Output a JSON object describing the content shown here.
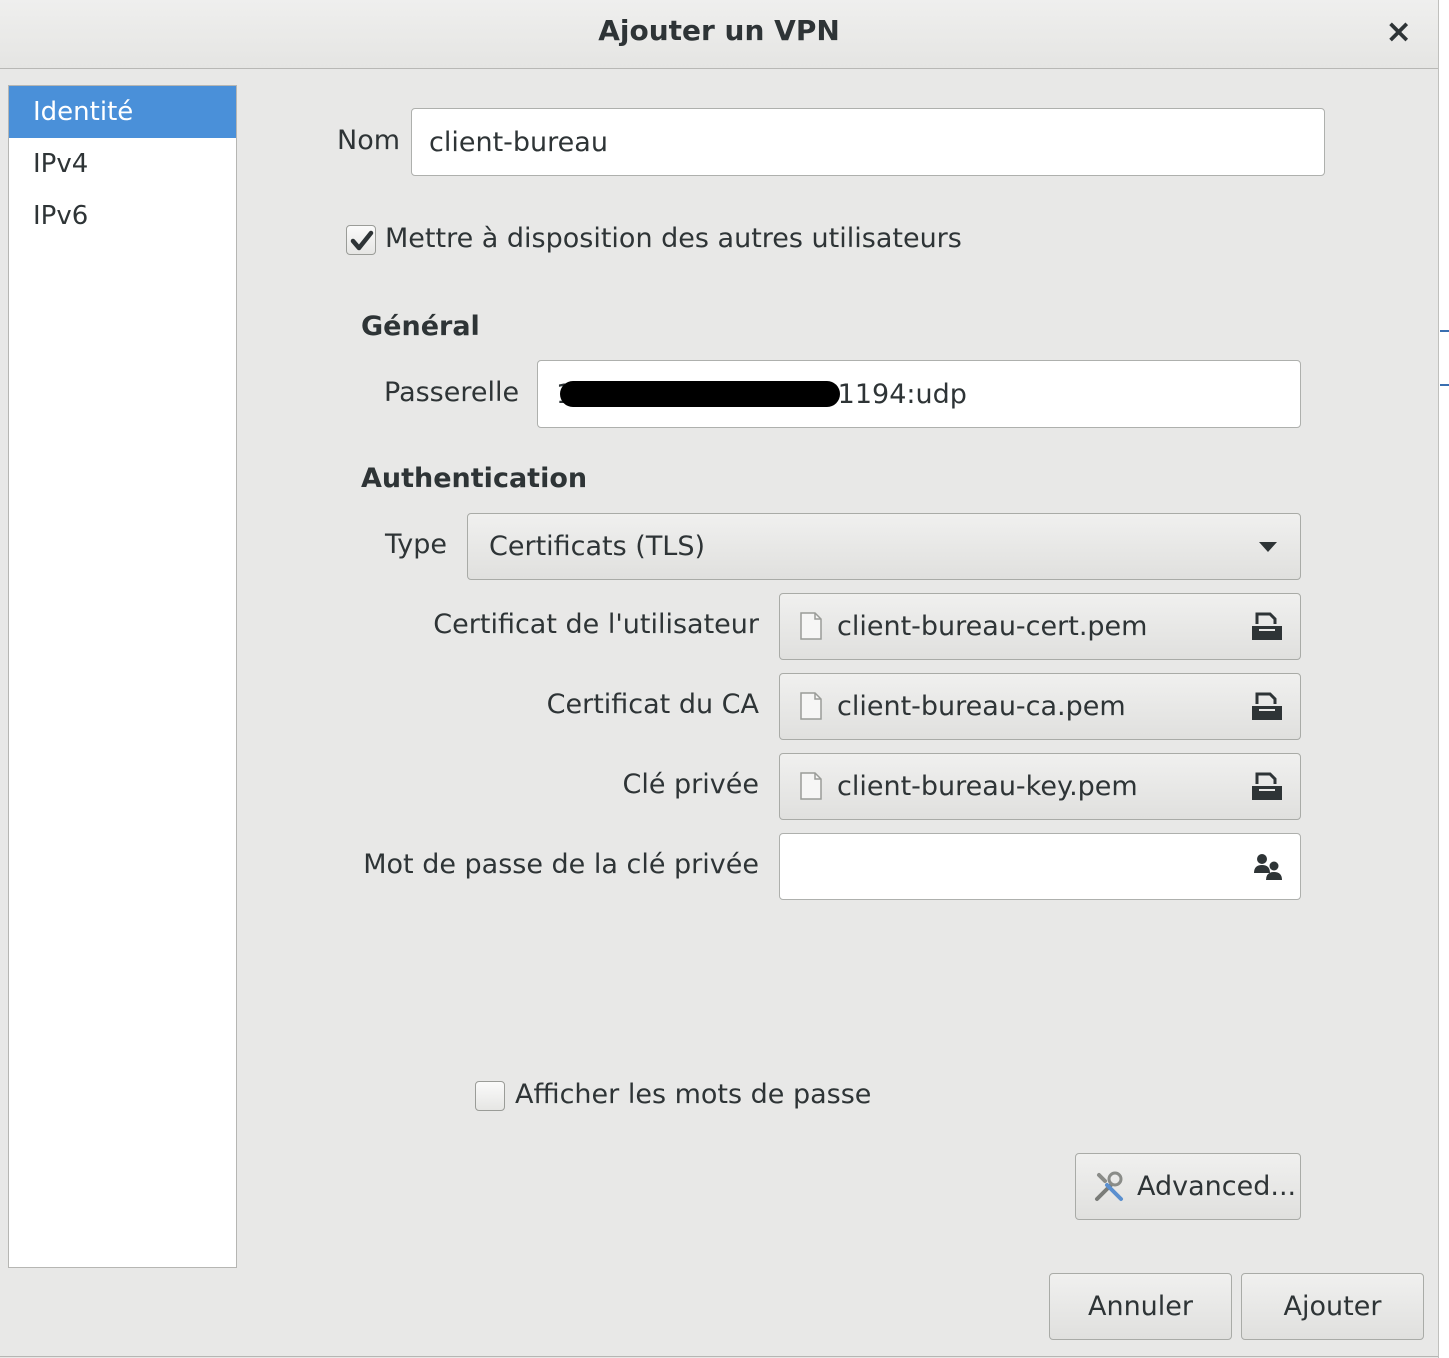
{
  "window": {
    "title": "Ajouter un VPN",
    "close_glyph": "×"
  },
  "sidebar": {
    "items": [
      {
        "label": "Identité",
        "selected": true
      },
      {
        "label": "IPv4",
        "selected": false
      },
      {
        "label": "IPv6",
        "selected": false
      }
    ]
  },
  "form": {
    "name_label": "Nom",
    "name_value": "client-bureau",
    "share_label": "Mettre à disposition des autres utilisateurs",
    "share_checked": true,
    "general_heading": "Général",
    "gateway_label": "Passerelle",
    "gateway_prefix": "1",
    "gateway_suffix": "t:1194:udp",
    "auth_heading": "Authentication",
    "type_label": "Type",
    "type_value": "Certificats (TLS)",
    "user_cert_label": "Certificat de l'utilisateur",
    "user_cert_file": "client-bureau-cert.pem",
    "ca_cert_label": "Certificat du CA",
    "ca_cert_file": "client-bureau-ca.pem",
    "private_key_label": "Clé privée",
    "private_key_file": "client-bureau-key.pem",
    "key_password_label": "Mot de passe de la clé privée",
    "key_password_value": "",
    "show_passwords_label": "Afficher les mots de passe",
    "show_passwords_checked": false
  },
  "buttons": {
    "advanced": "Advanced...",
    "cancel": "Annuler",
    "add": "Ajouter"
  },
  "colors": {
    "selection": "#4a90d9",
    "window_bg": "#e8e8e7"
  },
  "icons": [
    "close-icon",
    "check-icon",
    "dropdown-arrow-icon",
    "file-icon",
    "folder-open-icon",
    "users-icon",
    "tools-icon"
  ]
}
